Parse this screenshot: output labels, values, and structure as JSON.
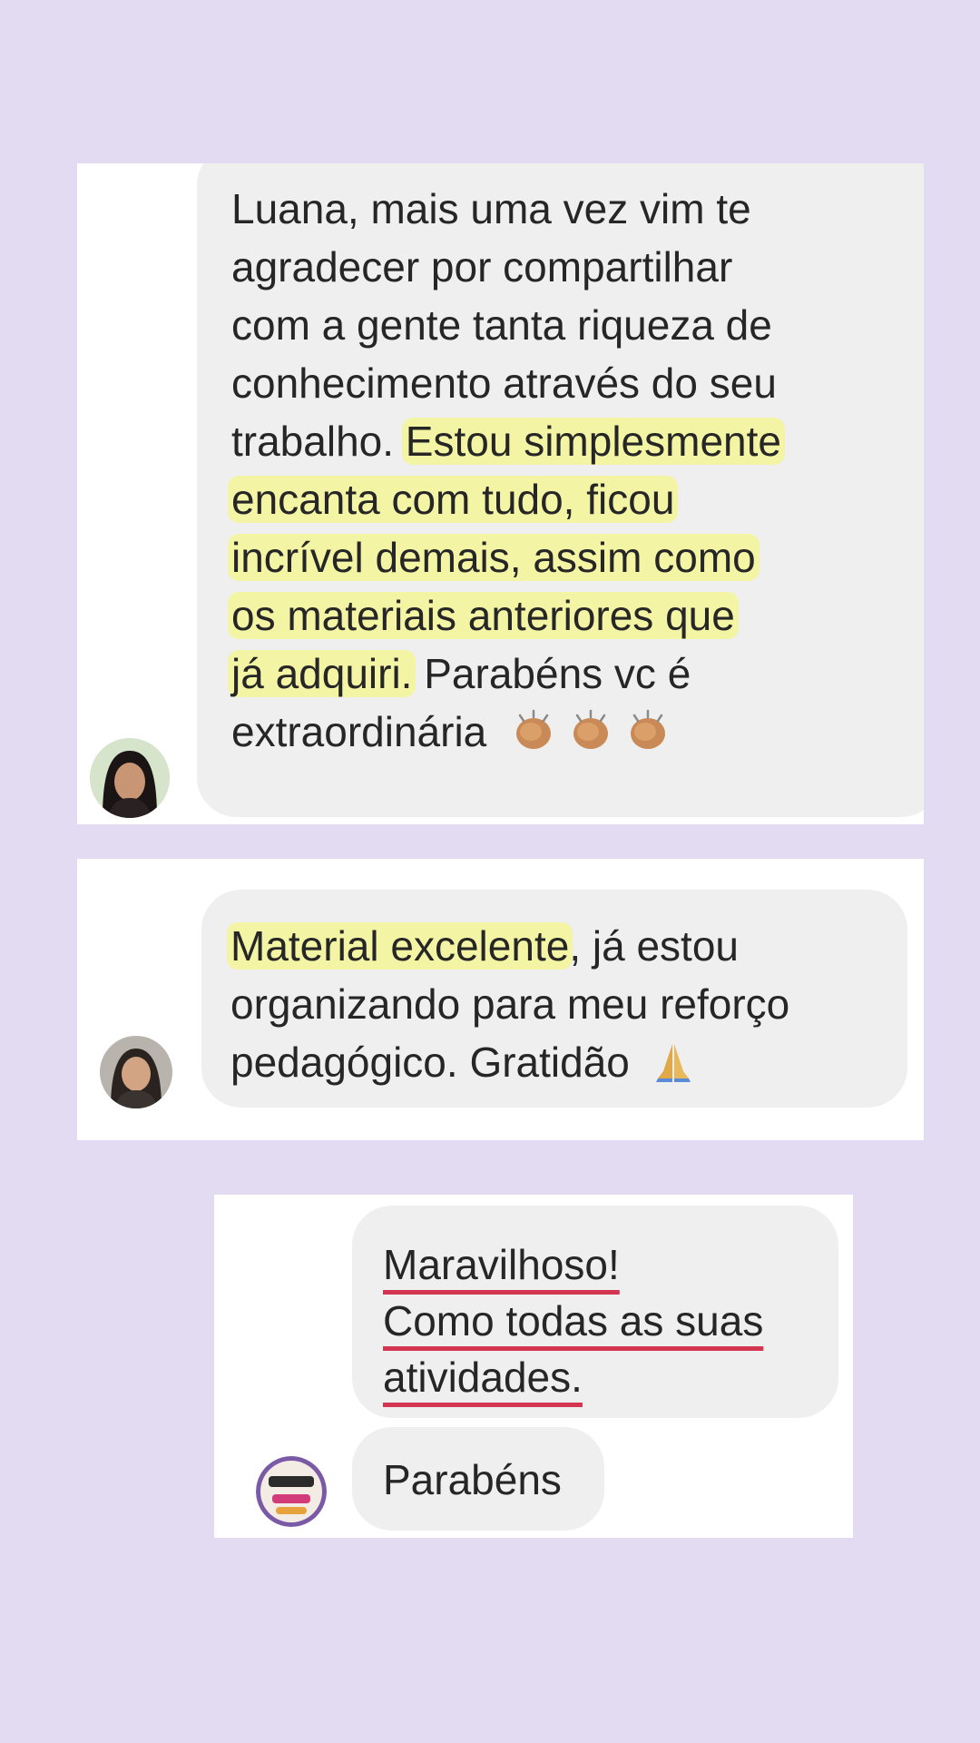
{
  "messages": [
    {
      "lines": [
        "Luana, mais uma vez vim te",
        "agradecer por compartilhar",
        "com a gente tanta riqueza de",
        "conhecimento através do seu"
      ],
      "line5_plain": "trabalho. ",
      "line5_hl": "Estou simplesmente",
      "line6_hl": "encanta com tudo, ficou",
      "line7_hl": "incrível demais, assim como",
      "line8_hl": "os materiais anteriores que",
      "line9_hl": "já adquiri.",
      "line9_plain": " Parabéns vc é",
      "line10_plain": "extraordinária",
      "emoji": "clapping-hands-emoji x3"
    },
    {
      "line1_hl": "Material excelente",
      "line1_plain": ", já estou",
      "line2": "organizando para meu reforço",
      "line3_plain": "pedagógico. Gratidão",
      "emoji": "folded-hands-emoji"
    },
    {
      "line1": "Maravilhoso!",
      "line2": "Como todas as suas",
      "line3": "atividades.",
      "reply": "Parabéns"
    }
  ],
  "colors": {
    "background": "#e3dbf1",
    "bubble": "#efefef",
    "highlight": "#f5f58c",
    "underline": "#d3344f"
  }
}
